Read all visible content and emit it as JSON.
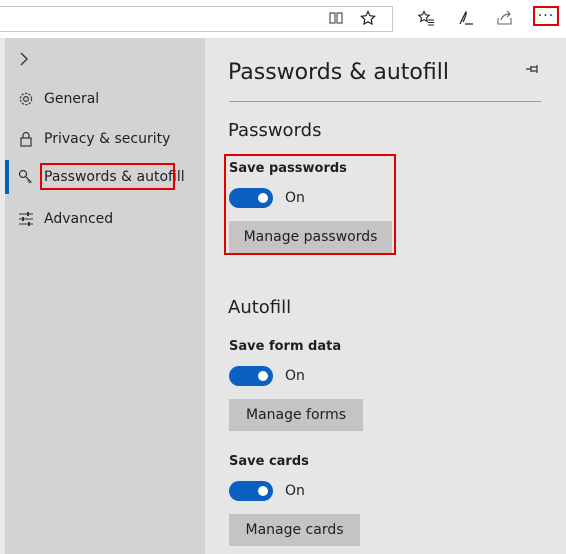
{
  "toolbar": {
    "icons": [
      "reading-view-icon",
      "favorite-star-icon",
      "favorites-hub-icon",
      "pen-icon",
      "share-icon",
      "more-icon"
    ],
    "more_label": "···"
  },
  "sidebar": {
    "items": [
      {
        "label": "General",
        "icon": "gear-icon"
      },
      {
        "label": "Privacy & security",
        "icon": "lock-icon"
      },
      {
        "label": "Passwords & autofill",
        "icon": "key-icon"
      },
      {
        "label": "Advanced",
        "icon": "sliders-icon"
      }
    ],
    "active_index": 2
  },
  "panel": {
    "title": "Passwords & autofill",
    "passwords": {
      "heading": "Passwords",
      "label": "Save passwords",
      "state": "On",
      "button": "Manage passwords"
    },
    "autofill": {
      "heading": "Autofill",
      "form_label": "Save form data",
      "form_state": "On",
      "form_button": "Manage forms",
      "cards_label": "Save cards",
      "cards_state": "On",
      "cards_button": "Manage cards"
    }
  },
  "colors": {
    "accent": "#0a5fc1",
    "highlight": "#e00000",
    "sidebar": "#d3d3d3",
    "panel": "#e6e6e6"
  }
}
